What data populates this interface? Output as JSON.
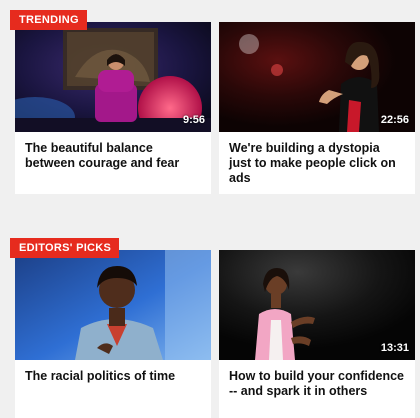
{
  "sections": [
    {
      "badge": "TRENDING",
      "cards": [
        {
          "title": "The beautiful balance between courage and fear",
          "duration": "9:56",
          "thumbnail": "speaker-on-stage-red-dress"
        },
        {
          "title": "We're building a dystopia just to make people click on ads",
          "duration": "22:56",
          "thumbnail": "speaker-dark-stage-curly-hair"
        }
      ]
    },
    {
      "badge": "EDITORS' PICKS",
      "cards": [
        {
          "title": "The racial politics of time",
          "duration": "",
          "thumbnail": "speaker-closeup-blue-background"
        },
        {
          "title": "How to build your confidence -- and spark it in others",
          "duration": "13:31",
          "thumbnail": "speaker-pink-blazer-dark-stage"
        }
      ]
    }
  ],
  "colors": {
    "badge": "#e62b1e",
    "page_background": "#f0f0f0",
    "card_background": "#ffffff",
    "title_text": "#111111"
  }
}
